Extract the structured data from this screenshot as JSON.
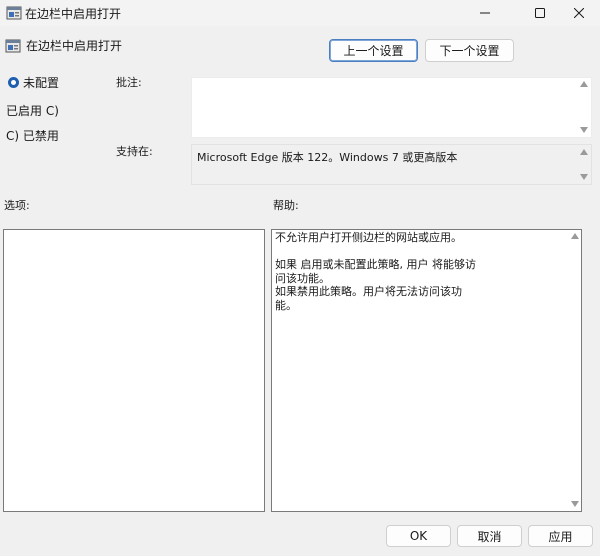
{
  "window": {
    "title": "在边栏中启用打开",
    "icon": "policy-settings-icon",
    "controls": [
      "minimize-icon",
      "maximize-icon",
      "close-icon"
    ]
  },
  "header": {
    "policy_title": "在边栏中启用打开",
    "prev_button": "上一个设置",
    "next_button": "下一个设置"
  },
  "state": {
    "options": [
      {
        "label": "未配置",
        "selected": true
      },
      {
        "label": "已启用 C)",
        "selected": false
      },
      {
        "label": "C) 已禁用",
        "selected": false
      }
    ]
  },
  "comment": {
    "label": "批注:",
    "value": ""
  },
  "supported": {
    "label": "支持在:",
    "value": "Microsoft Edge 版本 122。Windows 7 或更高版本"
  },
  "options_section": {
    "label": "选项:"
  },
  "help_section": {
    "label": "帮助:",
    "text": "不允许用户打开侧边栏的网站或应用。\n\n如果 启用或未配置此策略, 用户 将能够访\n问该功能。\n如果禁用此策略。用户将无法访问该功\n能。"
  },
  "footer": {
    "ok": "OK",
    "cancel": "取消",
    "apply": "应用"
  },
  "colors": {
    "accent": "#1f5fb0",
    "background": "#f0f0f0"
  }
}
